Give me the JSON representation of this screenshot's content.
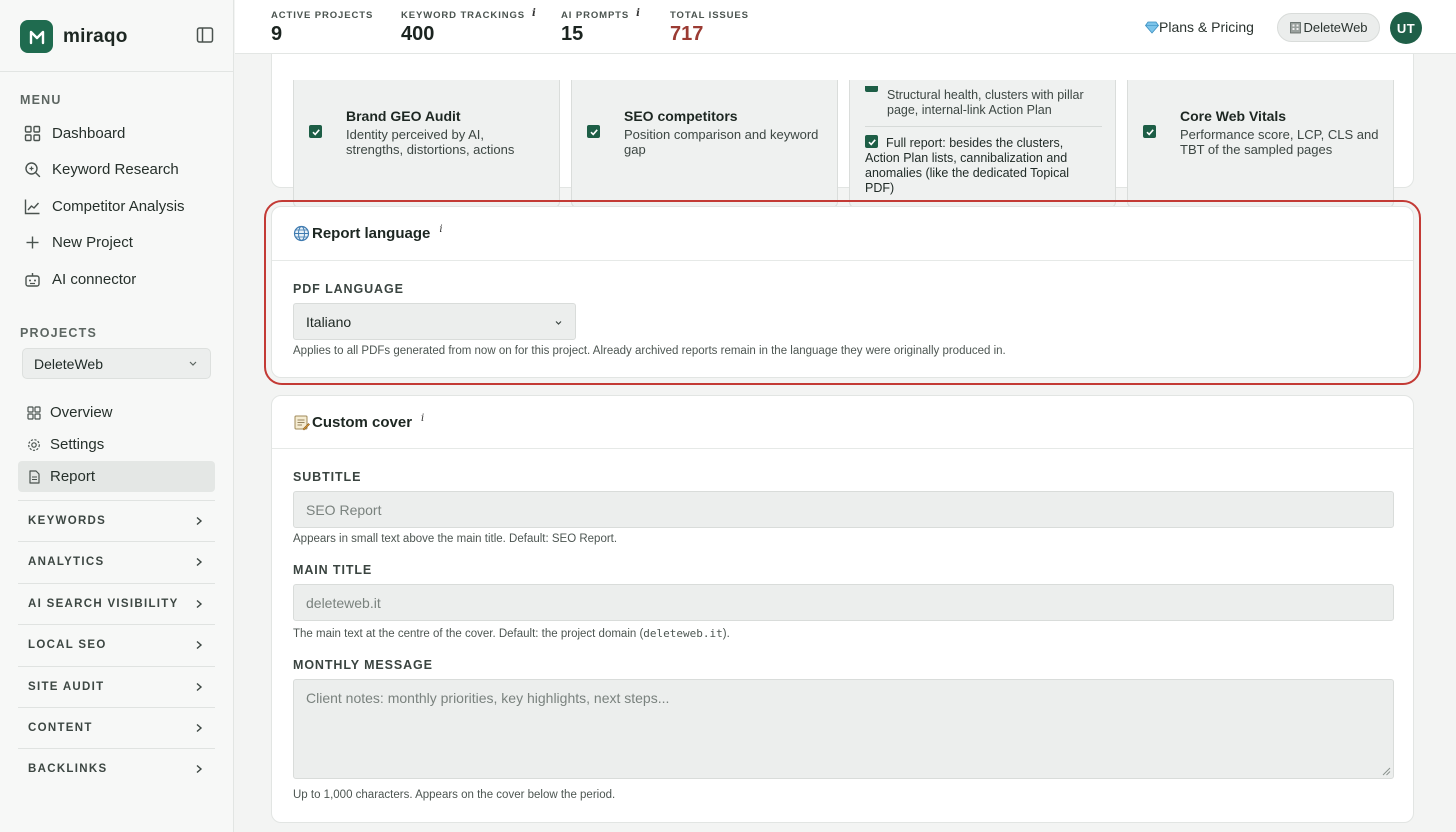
{
  "brand": {
    "name": "miraqo"
  },
  "sidebar": {
    "menu_label": "MENU",
    "menu": [
      {
        "label": "Dashboard",
        "icon": "dashboard-icon"
      },
      {
        "label": "Keyword Research",
        "icon": "search-icon"
      },
      {
        "label": "Competitor Analysis",
        "icon": "chart-line-icon"
      },
      {
        "label": "New Project",
        "icon": "plus-icon"
      },
      {
        "label": "AI connector",
        "icon": "robot-icon"
      }
    ],
    "projects_label": "PROJECTS",
    "project_selected": "DeleteWeb",
    "project_nav": [
      {
        "label": "Overview",
        "icon": "grid-icon"
      },
      {
        "label": "Settings",
        "icon": "gear-icon"
      },
      {
        "label": "Report",
        "icon": "document-icon",
        "active": true
      }
    ],
    "groups": [
      "KEYWORDS",
      "ANALYTICS",
      "AI SEARCH VISIBILITY",
      "LOCAL SEO",
      "SITE AUDIT",
      "CONTENT",
      "BACKLINKS"
    ]
  },
  "topbar": {
    "stats": [
      {
        "label": "ACTIVE PROJECTS",
        "value": "9",
        "info": ""
      },
      {
        "label": "KEYWORD TRACKINGS",
        "value": "400",
        "info": "i"
      },
      {
        "label": "AI PROMPTS",
        "value": "15",
        "info": "i"
      },
      {
        "label": "TOTAL ISSUES",
        "value": "717",
        "info": ""
      }
    ],
    "plans_label": "Plans & Pricing",
    "workspace_label": "DeleteWeb",
    "avatar_initials": "UT"
  },
  "options": [
    {
      "title": "Brand GEO Audit",
      "desc": "Identity perceived by AI, strengths, distortions, actions",
      "checked": true
    },
    {
      "title": "SEO competitors",
      "desc": "Position comparison and keyword gap",
      "checked": true
    },
    {
      "partial_desc": "Structural health, clusters with pillar page, internal-link Action Plan",
      "full_desc": "Full report: besides the clusters, Action Plan lists, cannibalization and anomalies (like the dedicated Topical PDF)",
      "checked": true
    },
    {
      "title": "Core Web Vitals",
      "desc": "Performance score, LCP, CLS and TBT of the sampled pages",
      "checked": true
    }
  ],
  "report_language": {
    "title": "Report language",
    "info": "i",
    "field_label": "PDF LANGUAGE",
    "selected": "Italiano",
    "help": "Applies to all PDFs generated from now on for this project. Already archived reports remain in the language they were originally produced in."
  },
  "custom_cover": {
    "title": "Custom cover",
    "info": "i",
    "subtitle_label": "SUBTITLE",
    "subtitle_placeholder": "SEO Report",
    "subtitle_help": "Appears in small text above the main title. Default: SEO Report.",
    "main_title_label": "MAIN TITLE",
    "main_title_placeholder": "deleteweb.it",
    "main_title_help_pre": "The main text at the centre of the cover. Default: the project domain (",
    "main_title_help_code": "deleteweb.it",
    "main_title_help_post": ").",
    "message_label": "MONTHLY MESSAGE",
    "message_placeholder": "Client notes: monthly priorities, key highlights, next steps...",
    "message_help": "Up to 1,000 characters. Appears on the cover below the period."
  },
  "colors": {
    "brand": "#1f6b4f",
    "issues": "#9b3b33",
    "highlight": "#c33a35",
    "checkbox": "#1d5e46"
  }
}
